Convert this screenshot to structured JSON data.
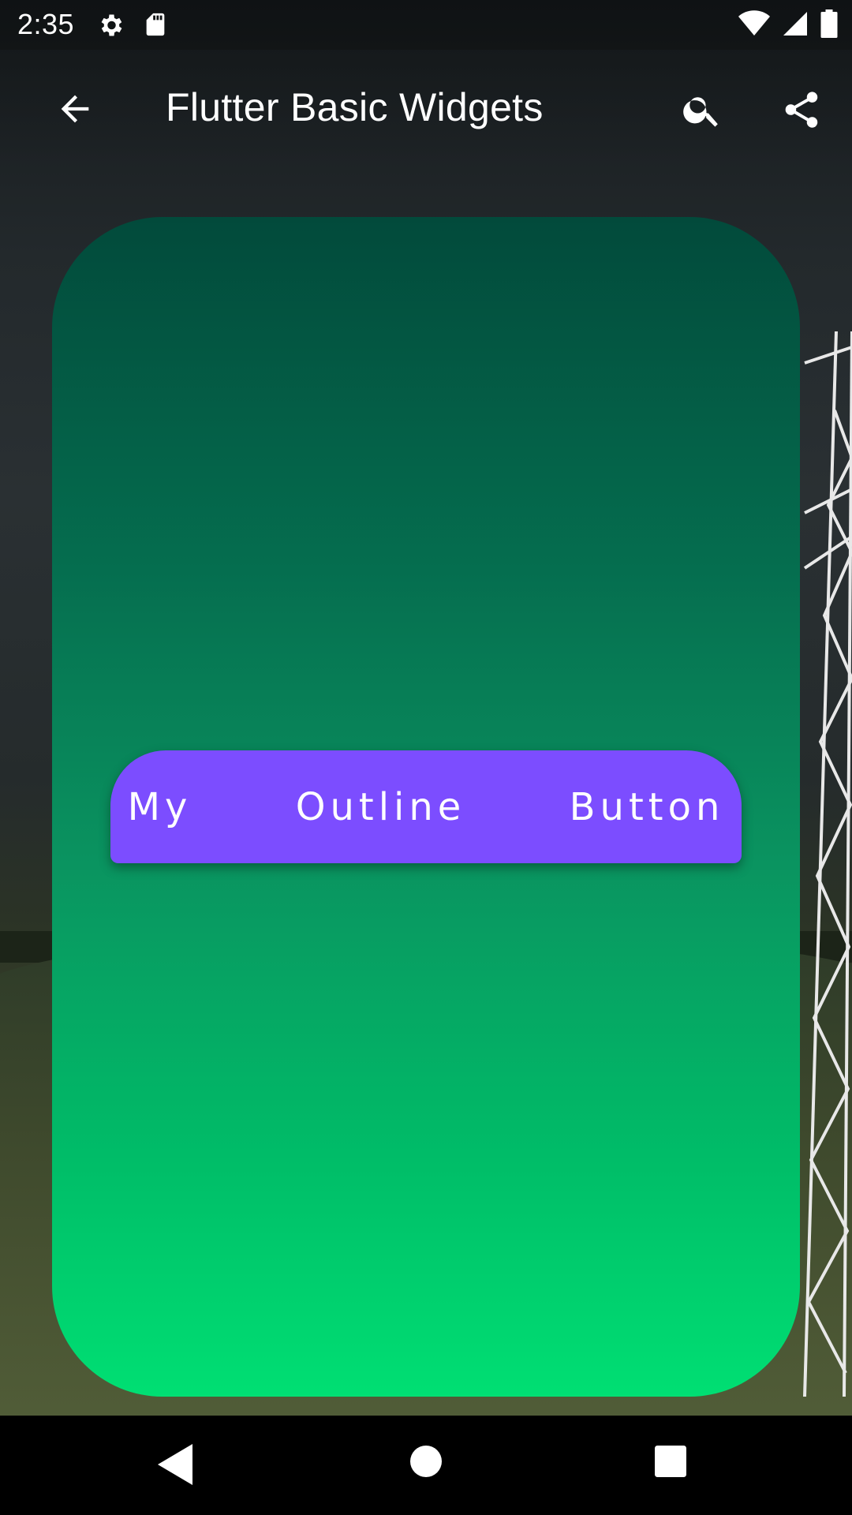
{
  "status_bar": {
    "time": "2:35",
    "left_icons": [
      "settings-icon",
      "sd-card-icon"
    ],
    "right_icons": [
      "wifi-icon",
      "signal-icon",
      "battery-icon"
    ]
  },
  "app_bar": {
    "title": "Flutter Basic Widgets",
    "actions": [
      "search-icon",
      "share-icon"
    ],
    "navigation_icon": "back-arrow-icon"
  },
  "content": {
    "card_gradient": [
      "#024a3b",
      "#00df73"
    ],
    "button": {
      "label": "My Outline Button",
      "color": "#7c4dff",
      "text_color": "#ffffff"
    }
  },
  "nav_bar": {
    "buttons": [
      "back-triangle-icon",
      "home-circle-icon",
      "recents-square-icon"
    ]
  }
}
